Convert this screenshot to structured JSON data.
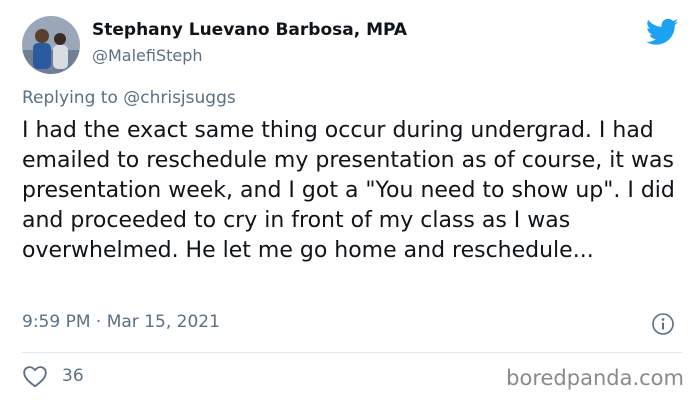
{
  "author": {
    "name": "Stephany Luevano Barbosa, MPA",
    "handle": "@MalefiSteph"
  },
  "reply_to": "Replying to @chrisjsuggs",
  "tweet": {
    "text": "I had the exact same thing occur during undergrad. I had emailed to reschedule my presentation as of course, it was presentation week, and I got a \"You need to show up\". I did and proceeded to cry in front of my class as I was overwhelmed. He let me go home and reschedule...",
    "timestamp": "9:59 PM · Mar 15, 2021"
  },
  "actions": {
    "like_count": "36"
  },
  "watermark": "boredpanda.com",
  "icons": {
    "logo": "twitter-bird-icon",
    "info": "info-icon",
    "like": "heart-icon"
  },
  "colors": {
    "twitter_blue": "#1da1f2",
    "secondary_text": "#5b7083",
    "primary_text": "#0f1419"
  }
}
